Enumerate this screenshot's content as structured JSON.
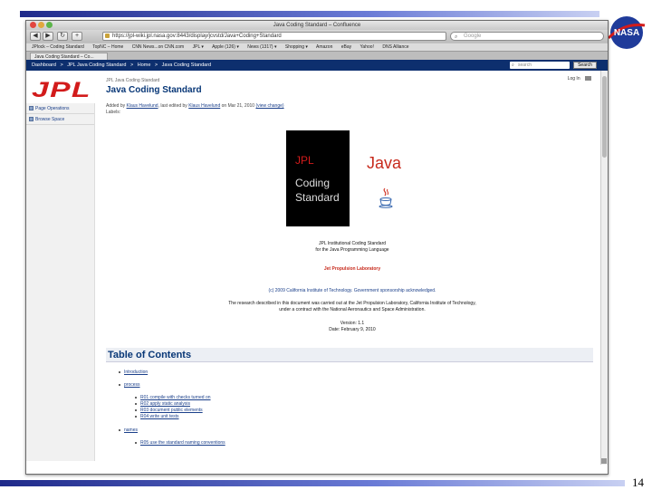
{
  "slide": {
    "page_number": "14"
  },
  "window": {
    "title": "Java Coding Standard – Confluence"
  },
  "toolbar": {
    "back": "◀",
    "forward": "▶",
    "reload": "↻",
    "add": "+",
    "url": "https://jpl-wiki.jpl.nasa.gov:8443/display/jcvstd/Java+Coding+Standard",
    "search_placeholder": "Google"
  },
  "bookmarks": [
    "JPlock – Coding Standard",
    "TopNC – Home",
    "CNN News...on CNN.com",
    "JPL ▾",
    "Apple (126) ▾",
    "News (1317) ▾",
    "Shopping ▾",
    "Amazon",
    "eBay",
    "Yahoo!",
    "DNS Alliance"
  ],
  "tab": {
    "label": "Java Coding Standard – Co..."
  },
  "confluence": {
    "breadcrumbs": [
      "Dashboard",
      ">",
      "JPL Java Coding Standard",
      ">",
      "Home",
      ">",
      "Java Coding Standard"
    ],
    "search_placeholder": "search",
    "search_button": "Search",
    "login": "Log In"
  },
  "sidebar": {
    "items": [
      "Page Operations",
      "Browse Space"
    ]
  },
  "page": {
    "breadcrumb": "JPL Java Coding Standard",
    "title": "Java Coding Standard",
    "meta_prefix": "Added by",
    "meta_author": "Klaus Havelund",
    "meta_mid": ", last edited by",
    "meta_editor": "Klaus Havelund",
    "meta_date": "on Mar 21, 2010",
    "meta_link": "(view change)",
    "labels": "Labels:"
  },
  "cover": {
    "jpl": "JPL",
    "line1": "Coding",
    "line2": "Standard",
    "java": "Java"
  },
  "center_text": {
    "line1": "JPL Institutional Coding Standard",
    "line2": "for the Java Programming Language",
    "lab": "Jet Propulsion Laboratory",
    "copyright": "(c) 2009 California Institute of Technology. Government sponsorship acknowledged.",
    "research1": "The research described in this document was carried out at the Jet Propulsion Laboratory, California Institute of Technology,",
    "research2": "under a contract with the National Aeronautics and Space Administration.",
    "version": "Version: 1.1",
    "date": "Date: February 9, 2010"
  },
  "toc": {
    "title": "Table of Contents",
    "items": [
      "Introduction",
      "process",
      "R01 compile with checks turned on",
      "R02 apply static analysis",
      "R03 document public elements",
      "R04 write unit tests",
      "names",
      "R05 use the standard naming conventions"
    ]
  }
}
